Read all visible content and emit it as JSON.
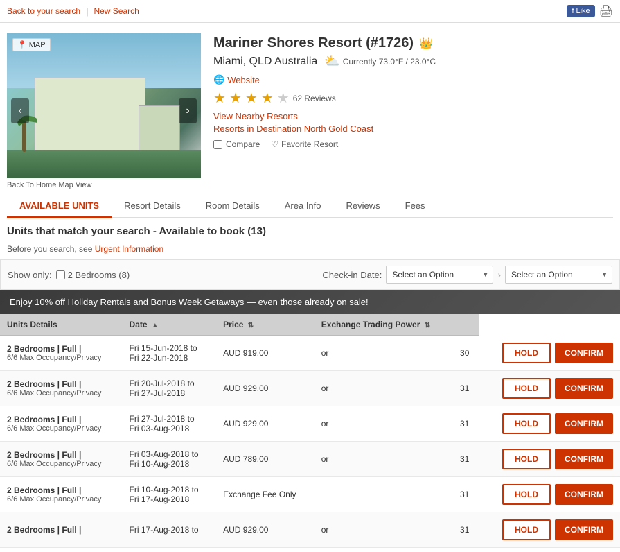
{
  "topbar": {
    "back_label": "Back to your search",
    "new_search_label": "New Search",
    "fb_like": "Like",
    "print_title": "Print"
  },
  "resort": {
    "name": "Mariner Shores Resort (#1726)",
    "location": "Miami, QLD   Australia",
    "weather": "Currently 73.0°F / 23.0°C",
    "website_label": "Website",
    "reviews_count": "62 Reviews",
    "nearby_label": "View Nearby Resorts",
    "destination_label": "Resorts in Destination North Gold Coast",
    "compare_label": "Compare",
    "favorite_label": "Favorite Resort",
    "back_home_map": "Back To Home Map View",
    "map_label": "MAP"
  },
  "tabs": [
    {
      "id": "available-units",
      "label": "AVAILABLE UNITS",
      "active": true
    },
    {
      "id": "resort-details",
      "label": "Resort Details",
      "active": false
    },
    {
      "id": "room-details",
      "label": "Room Details",
      "active": false
    },
    {
      "id": "area-info",
      "label": "Area Info",
      "active": false
    },
    {
      "id": "reviews",
      "label": "Reviews",
      "active": false
    },
    {
      "id": "fees",
      "label": "Fees",
      "active": false
    }
  ],
  "units_section": {
    "title": "Units that match your search - Available to book (13)",
    "urgent_prefix": "Before you search, see",
    "urgent_link": "Urgent Information",
    "show_only_label": "Show only:",
    "checkbox_label": "2 Bedrooms (8)",
    "checkin_label": "Check-in Date:",
    "select1_placeholder": "Select an Option",
    "select2_placeholder": "Select an Option"
  },
  "promo": {
    "text": "Enjoy 10% off Holiday Rentals and Bonus Week Getaways — even those already on sale!"
  },
  "table": {
    "headers": [
      {
        "id": "unit-details",
        "label": "Units Details"
      },
      {
        "id": "date",
        "label": "Date",
        "sortable": true
      },
      {
        "id": "price",
        "label": "Price",
        "sortable": true
      },
      {
        "id": "exchange",
        "label": "Exchange Trading Power",
        "sortable": true
      },
      {
        "id": "actions",
        "label": ""
      }
    ],
    "rows": [
      {
        "unit_name": "2 Bedrooms | Full |",
        "unit_sub": "6/6 Max Occupancy/Privacy",
        "date_from": "Fri 15-Jun-2018 to",
        "date_to": "Fri 22-Jun-2018",
        "price": "AUD 919.00",
        "or": "or",
        "exchange": "30",
        "hold_label": "HOLD",
        "confirm_label": "CONFIRM"
      },
      {
        "unit_name": "2 Bedrooms | Full |",
        "unit_sub": "6/6 Max Occupancy/Privacy",
        "date_from": "Fri 20-Jul-2018 to",
        "date_to": "Fri 27-Jul-2018",
        "price": "AUD 929.00",
        "or": "or",
        "exchange": "31",
        "hold_label": "HOLD",
        "confirm_label": "CONFIRM"
      },
      {
        "unit_name": "2 Bedrooms | Full |",
        "unit_sub": "6/6 Max Occupancy/Privacy",
        "date_from": "Fri 27-Jul-2018 to",
        "date_to": "Fri 03-Aug-2018",
        "price": "AUD 929.00",
        "or": "or",
        "exchange": "31",
        "hold_label": "HOLD",
        "confirm_label": "CONFIRM"
      },
      {
        "unit_name": "2 Bedrooms | Full |",
        "unit_sub": "6/6 Max Occupancy/Privacy",
        "date_from": "Fri 03-Aug-2018 to",
        "date_to": "Fri 10-Aug-2018",
        "price": "AUD 789.00",
        "or": "or",
        "exchange": "31",
        "hold_label": "HOLD",
        "confirm_label": "CONFIRM"
      },
      {
        "unit_name": "2 Bedrooms | Full |",
        "unit_sub": "6/6 Max Occupancy/Privacy",
        "date_from": "Fri 10-Aug-2018 to",
        "date_to": "Fri 17-Aug-2018",
        "price": "Exchange Fee Only",
        "or": "",
        "exchange": "31",
        "hold_label": "HOLD",
        "confirm_label": "CONFIRM"
      },
      {
        "unit_name": "2 Bedrooms | Full |",
        "unit_sub": "",
        "date_from": "Fri 17-Aug-2018 to",
        "date_to": "",
        "price": "AUD 929.00",
        "or": "or",
        "exchange": "31",
        "hold_label": "HOLD",
        "confirm_label": "CONFIRM"
      }
    ]
  },
  "stars": [
    "★",
    "★",
    "★",
    "★",
    "☆"
  ]
}
